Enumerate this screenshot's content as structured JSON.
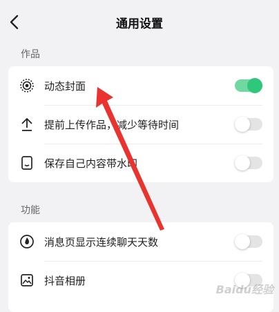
{
  "header": {
    "title": "通用设置",
    "back_icon": "chevron-left-icon"
  },
  "sections": [
    {
      "label": "作品",
      "items": [
        {
          "label": "动态封面",
          "icon": "dynamic-cover-icon",
          "enabled": true
        },
        {
          "label": "提前上传作品，减少等待时间",
          "icon": "upload-arrow-icon",
          "enabled": false
        },
        {
          "label": "保存自己内容带水印",
          "icon": "phone-save-icon",
          "enabled": false
        }
      ]
    },
    {
      "label": "功能",
      "items": [
        {
          "label": "消息页显示连续聊天天数",
          "icon": "flame-icon",
          "enabled": false
        },
        {
          "label": "抖音相册",
          "icon": "album-icon",
          "enabled": false
        }
      ]
    }
  ],
  "colors": {
    "toggle_on_track": "#6fd9a1",
    "toggle_on_knob": "#2fc77a",
    "annotation_arrow": "#e8332e"
  },
  "watermark": "Baidu经验"
}
